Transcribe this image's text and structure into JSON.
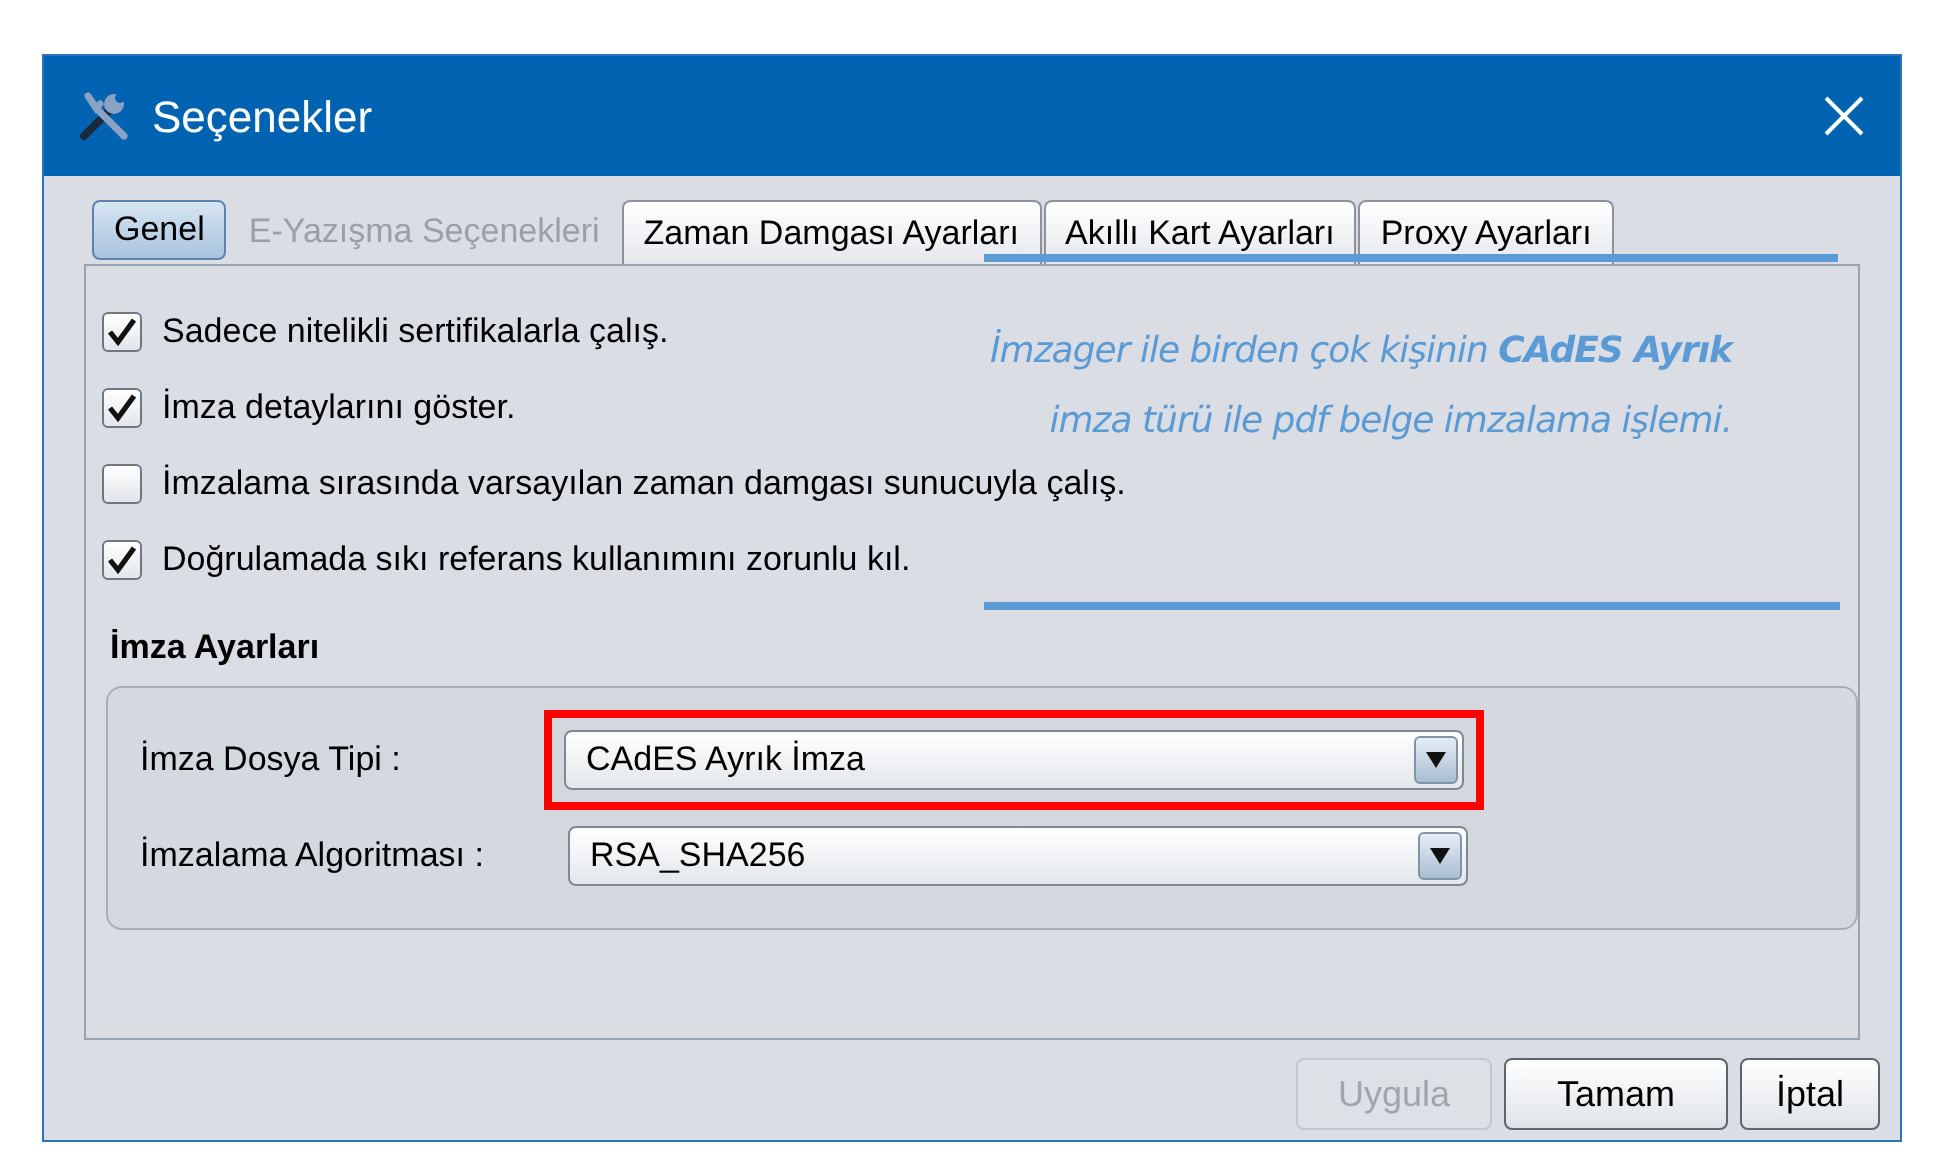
{
  "window": {
    "title": "Seçenekler"
  },
  "tabs": [
    {
      "label": "Genel",
      "selected": true,
      "disabled": false
    },
    {
      "label": "E-Yazışma Seçenekleri",
      "selected": false,
      "disabled": true
    },
    {
      "label": "Zaman Damgası Ayarları",
      "selected": false,
      "disabled": false
    },
    {
      "label": "Akıllı Kart Ayarları",
      "selected": false,
      "disabled": false
    },
    {
      "label": "Proxy Ayarları",
      "selected": false,
      "disabled": false
    }
  ],
  "options": [
    {
      "label": "Sadece nitelikli sertifikalarla çalış.",
      "checked": true
    },
    {
      "label": "İmza detaylarını göster.",
      "checked": true
    },
    {
      "label": "İmzalama sırasında varsayılan zaman damgası sunucuyla çalış.",
      "checked": false
    },
    {
      "label": "Doğrulamada sıkı referans kullanımını zorunlu kıl.",
      "checked": true
    }
  ],
  "signature_settings": {
    "title": "İmza Ayarları",
    "fields": [
      {
        "label": "İmza Dosya Tipi :",
        "value": "CAdES Ayrık İmza",
        "highlighted": true
      },
      {
        "label": "İmzalama Algoritması :",
        "value": "RSA_SHA256",
        "highlighted": false
      }
    ]
  },
  "annotation": {
    "lines": [
      "İmzager ile birden çok kişinin **CAdES Ayrık**",
      "imza türü ile pdf belge imzalama işlemi."
    ]
  },
  "buttons": [
    {
      "label": "Uygula",
      "disabled": true
    },
    {
      "label": "Tamam",
      "disabled": false
    },
    {
      "label": "İptal",
      "disabled": false
    }
  ]
}
